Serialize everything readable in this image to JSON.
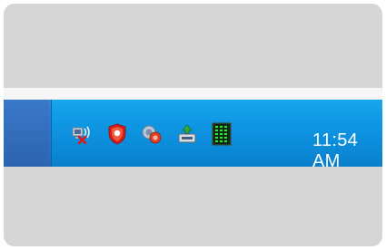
{
  "taskbar": {
    "clock": "11:54 AM",
    "tray_icons": [
      {
        "name": "wireless-network-disconnected-icon"
      },
      {
        "name": "security-shield-icon"
      },
      {
        "name": "sound-volume-icon"
      },
      {
        "name": "safely-remove-hardware-icon"
      },
      {
        "name": "cpu-meter-icon"
      }
    ]
  },
  "colors": {
    "taskbar_blue": "#2a77cc",
    "tray_blue": "#0f97e4",
    "background_gray": "#d6d6d6"
  }
}
